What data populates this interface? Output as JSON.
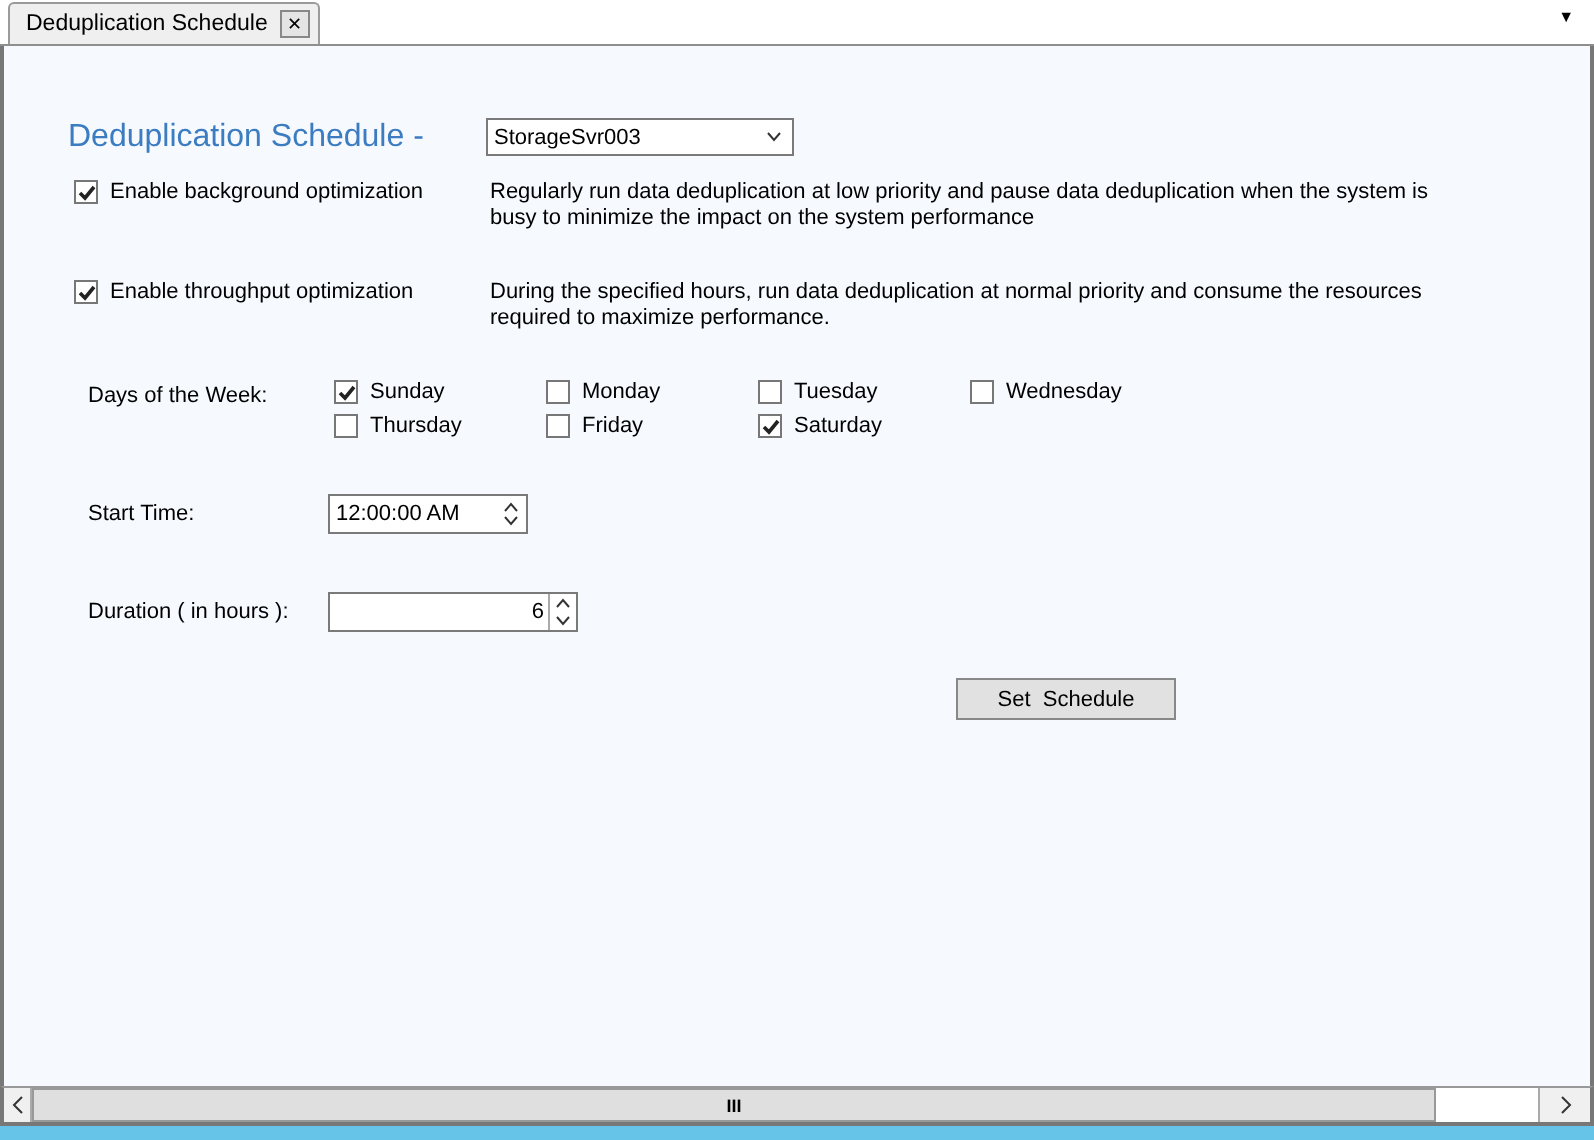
{
  "tab": {
    "label": "Deduplication Schedule",
    "close": "✕",
    "menu": "▼"
  },
  "heading": "Deduplication Schedule -",
  "server": {
    "value": "StorageSvr003"
  },
  "options": [
    {
      "label": "Enable background optimization",
      "checked": true,
      "description": "Regularly run data deduplication at low priority and pause data deduplication when the system is busy to minimize the impact on the system performance"
    },
    {
      "label": "Enable throughput optimization",
      "checked": true,
      "description": "During the specified hours, run data deduplication at normal priority and consume the resources required to maximize performance."
    }
  ],
  "days_label": "Days of the Week:",
  "days": [
    {
      "label": "Sunday",
      "checked": true
    },
    {
      "label": "Monday",
      "checked": false
    },
    {
      "label": "Tuesday",
      "checked": false
    },
    {
      "label": "Wednesday",
      "checked": false
    },
    {
      "label": "Thursday",
      "checked": false
    },
    {
      "label": "Friday",
      "checked": false
    },
    {
      "label": "Saturday",
      "checked": true
    }
  ],
  "start_time": {
    "label": "Start Time:",
    "value": "12:00:00 AM"
  },
  "duration": {
    "label": "Duration ( in hours ):",
    "value": "6"
  },
  "set_button": "Set  Schedule",
  "scrollbar_grip": "III"
}
